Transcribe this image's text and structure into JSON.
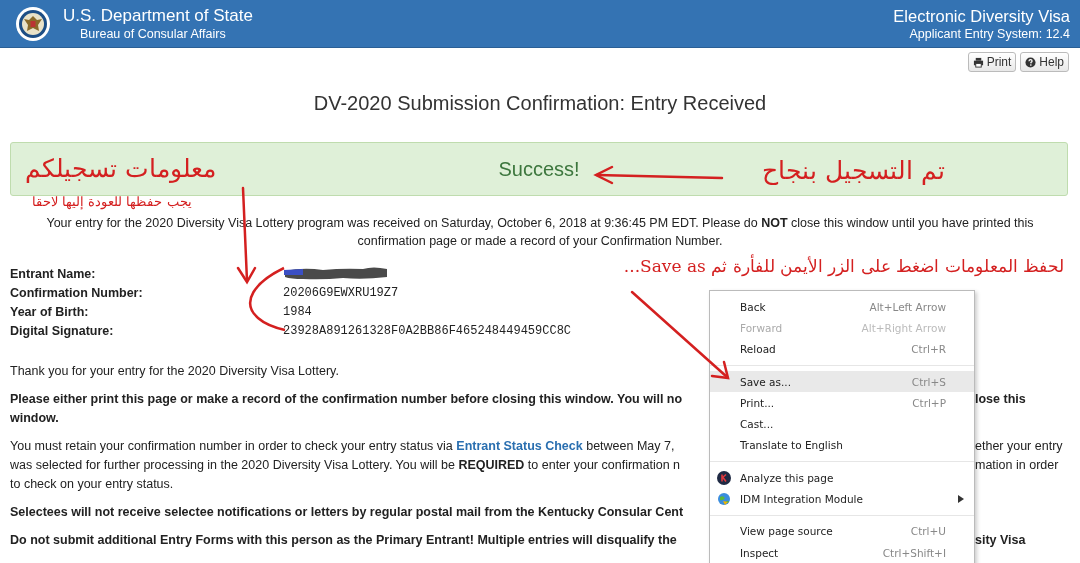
{
  "header": {
    "agency": "U.S. Department of State",
    "bureau": "Bureau of Consular Affairs",
    "system": "Electronic Diversity Visa",
    "version": "Applicant Entry System: 12.4"
  },
  "toolbar": [
    {
      "label": "Print",
      "kind": "print"
    },
    {
      "label": "Help",
      "kind": "help"
    }
  ],
  "title": "DV-2020 Submission Confirmation: Entry Received",
  "banner": "Success!",
  "received": "Your entry for the 2020 Diversity Visa Lottery program was received on Saturday, October 6, 2018 at 9:36:45 PM EDT. Please do **NOT** close this window until you have printed this confirmation page or made a record of your Confirmation Number.",
  "details": [
    {
      "label": "Entrant Name:"
    },
    {
      "label": "Confirmation Number:",
      "value": "20206G9EWXRU19Z7"
    },
    {
      "label": "Year of Birth:",
      "value": "1984"
    },
    {
      "label": "Digital Signature:",
      "value": "23928A891261328F0A2BB86F465248449459CC8C"
    }
  ],
  "paragraphs": [
    {
      "bold": false,
      "lines": [
        {
          "left": "Thank you for your entry for the 2020 Diversity Visa Lottery."
        }
      ]
    },
    {
      "bold": true,
      "lines": [
        {
          "left": "Please either print this page or make a record of the confirmation number before closing this window. You will no",
          "right": "lose this"
        },
        {
          "left": "window."
        }
      ]
    },
    {
      "bold": false,
      "lines": [
        {
          "left": "You must retain your confirmation number in order to check your entry status via",
          "link": "Entrant Status Check",
          "after": "between May 7,",
          "right": "ether your entry"
        },
        {
          "left": "was selected for further processing in the 2020 Diversity Visa Lottery. You will be **REQUIRED** to enter your confirmation n",
          "right": "mation in order"
        },
        {
          "left": "to check on your entry status."
        }
      ]
    },
    {
      "bold": true,
      "lines": [
        {
          "left": "Selectees will not receive selectee notifications or letters by regular postal mail from the Kentucky Consular Cent"
        }
      ]
    },
    {
      "bold": true,
      "lines": [
        {
          "left": "Do not submit additional Entry Forms with this person as the Primary Entrant! Multiple entries will disqualify the",
          "right": "sity Visa"
        }
      ]
    }
  ],
  "context_menu": [
    {
      "kind": "plain",
      "label": "Back",
      "shortcut": "Alt+Left Arrow",
      "disabled": false,
      "selected": false,
      "submenu": false
    },
    {
      "kind": "plain",
      "label": "Forward",
      "shortcut": "Alt+Right Arrow",
      "disabled": true,
      "selected": false,
      "submenu": false
    },
    {
      "kind": "plain",
      "label": "Reload",
      "shortcut": "Ctrl+R",
      "disabled": false,
      "selected": false,
      "submenu": false
    },
    {
      "kind": "separator"
    },
    {
      "kind": "plain",
      "label": "Save as...",
      "shortcut": "Ctrl+S",
      "disabled": false,
      "selected": true,
      "submenu": false
    },
    {
      "kind": "plain",
      "label": "Print...",
      "shortcut": "Ctrl+P",
      "disabled": false,
      "selected": false,
      "submenu": false
    },
    {
      "kind": "plain",
      "label": "Cast...",
      "disabled": false,
      "selected": false,
      "submenu": false
    },
    {
      "kind": "plain",
      "label": "Translate to English",
      "disabled": false,
      "selected": false,
      "submenu": false
    },
    {
      "kind": "separator"
    },
    {
      "kind": "analyzer",
      "label": "Analyze this page",
      "disabled": false,
      "selected": false,
      "submenu": false
    },
    {
      "kind": "downloader",
      "label": "IDM Integration Module",
      "disabled": false,
      "selected": false,
      "submenu": true
    },
    {
      "kind": "separator"
    },
    {
      "kind": "plain",
      "label": "View page source",
      "shortcut": "Ctrl+U",
      "disabled": false,
      "selected": false,
      "submenu": false
    },
    {
      "kind": "plain",
      "label": "Inspect",
      "shortcut": "Ctrl+Shift+I",
      "disabled": false,
      "selected": false,
      "submenu": false
    }
  ],
  "annotations": [
    {
      "kind": "success-note",
      "text": "تم التسجيل بنجاح"
    },
    {
      "kind": "info-note",
      "text": "معلومات تسجيلكم"
    },
    {
      "kind": "keep-note",
      "text": "يجب حفظها للعودة إليها لاحقا"
    },
    {
      "kind": "save-note",
      "text": "لحفظ المعلومات اضغط على الزر الأيمن للفأرة ثم Save as..."
    }
  ]
}
